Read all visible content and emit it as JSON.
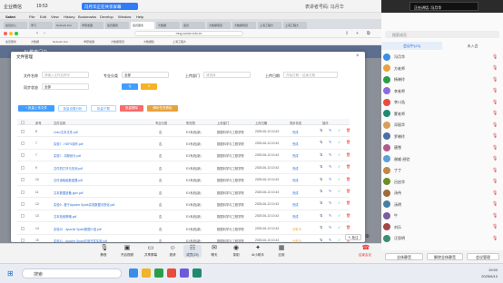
{
  "meeting_top": {
    "app_name": "企业微信",
    "timer": "19:53",
    "share_label": "冯月华正在共享屏幕",
    "network_label": "表讲者号码: 冯月华"
  },
  "mac_menu": {
    "items": [
      "Safari",
      "File",
      "Edit",
      "View",
      "History",
      "Bookmarks",
      "Develop",
      "Window",
      "Help"
    ]
  },
  "browser": {
    "tabs": [
      "会员办公",
      "学习",
      "Network Fun",
      "学研发展",
      "会员服务",
      "会员服务",
      "大数据",
      "会员",
      "大数据项目",
      "大数据项目",
      "上海工程大",
      "上海工程大"
    ],
    "url": "mng.xuean.edu.cn",
    "bookmarks": [
      "会员服务",
      "大数据",
      "Network Fun",
      "学研发展",
      "大数据项目",
      "大数据集",
      "上海工程大"
    ]
  },
  "site": {
    "header": "AI 教育门户"
  },
  "modal": {
    "title": "文件管理",
    "close": "×",
    "filters": {
      "file_name_label": "文件名称",
      "file_name_placeholder": "请输入文件名称字",
      "major_label": "专业分类",
      "major_value": "全部",
      "dept_label": "上传部门",
      "dept_placeholder": "请选择",
      "upload_time_label": "上传日期",
      "upload_time_placeholder": "开始日期 ~ 结束日期",
      "status_label": "同步状态",
      "status_value": "全部",
      "search_button": "Q",
      "reset_button": "↺"
    },
    "toolbar": {
      "upload": "+ 批量上传文件",
      "sync": "批量设置分析",
      "download": "批量下载",
      "delete": "批量删除",
      "export": "解析任务看板"
    },
    "columns": [
      "序号",
      "文件名称",
      "专业分类",
      "所在院",
      "上传部门",
      "上传日期",
      "同步状态",
      "操作"
    ],
    "rows": [
      {
        "no": "8",
        "name": "Linux文本文件.pdf",
        "major": "否",
        "college": "EX系统(新)",
        "dept": "数据科学与工程学院",
        "date": "2025-06-13 10:43",
        "status": "完成"
      },
      {
        "no": "7",
        "name": "实验7 - HDFS操作.pdf",
        "major": "否",
        "college": "EX系统(新)",
        "dept": "数据科学与工程学院",
        "date": "2025-06-13 10:43",
        "status": "完成"
      },
      {
        "no": "7",
        "name": "实验7 - 词频统计.pdf",
        "major": "否",
        "college": "EX系统(新)",
        "dept": "数据科学与工程学院",
        "date": "2025-06-13 10:43",
        "status": "完成"
      },
      {
        "no": "9",
        "name": "文件的打开与关闭.pdf",
        "major": "否",
        "college": "EX系统(新)",
        "dept": "数据科学与工程学院",
        "date": "2025-06-13 10:43",
        "status": "完成"
      },
      {
        "no": "10",
        "name": "文件读取函数重要.pdf",
        "major": "否",
        "college": "EX系统(新)",
        "dept": "数据科学与工程学院",
        "date": "2025-06-13 10:43",
        "status": "完成"
      },
      {
        "no": "11",
        "name": "文本数据准备.pptx.pdf",
        "major": "否",
        "college": "EX系统(新)",
        "dept": "数据科学与工程学院",
        "date": "2025-06-13 10:43",
        "status": "完成"
      },
      {
        "no": "12",
        "name": "实验9 - 基于Apache Spark实现数据可视化.pdf",
        "major": "否",
        "college": "EX系统(新)",
        "dept": "数据科学与工程学院",
        "date": "2025-06-13 10:43",
        "status": "完成"
      },
      {
        "no": "13",
        "name": "文本检索策略.pdf",
        "major": "否",
        "college": "EX系统(新)",
        "dept": "数据科学与工程学院",
        "date": "2025-06-13 10:43",
        "status": "完成"
      },
      {
        "no": "14",
        "name": "实验10 - Apache Spark数据介绍.pdf",
        "major": "否",
        "college": "EX系统(新)",
        "dept": "数据科学与工程学院",
        "date": "2025-06-13 10:43",
        "status": "分析中"
      },
      {
        "no": "15",
        "name": "实验11 - Apache Spark应用开发实验.pdf",
        "major": "否",
        "college": "EX系统(新)",
        "dept": "数据科学与工程学院",
        "date": "2025-06-13 10:43",
        "status": "分析中"
      }
    ]
  },
  "meeting_bar": {
    "items": [
      "静音",
      "开启视频",
      "共享屏幕",
      "邀请",
      "成员(23)",
      "聊天",
      "录制",
      "AI小助手",
      "应用",
      "结束会议"
    ]
  },
  "right_panel": {
    "pip_label": "正在讲话: 冯月华",
    "search_placeholder": "搜索成员",
    "tab_in_meeting": "会议中(23)",
    "tab_not_joined": "未入会",
    "members": [
      "冯月华",
      "方老师",
      "杨晓玲",
      "李老师",
      "李川浩",
      "蒙老师",
      "邓丽华",
      "罗晓玲",
      "唐雪",
      "谢威·经验",
      "丁丁",
      "吕启华",
      "汤伟",
      "汤明",
      "牛",
      "刘乐",
      "汪思明"
    ],
    "mute_all": "全体静音",
    "unmute_all": "解除全体静音",
    "settings": "会议管理"
  },
  "taskbar": {
    "search": "搜索",
    "time": "19:53",
    "date": "2025/6/13"
  }
}
